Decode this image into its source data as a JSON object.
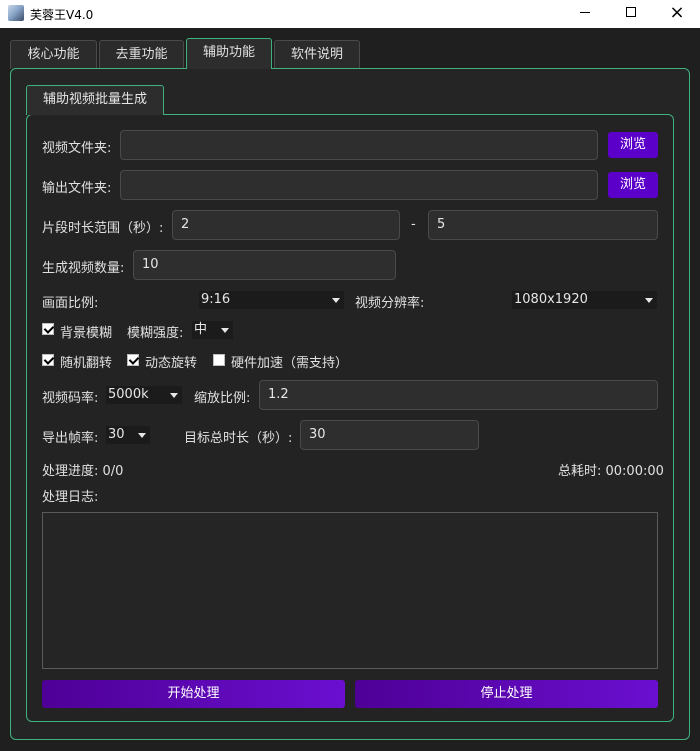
{
  "window": {
    "title": "芙蓉王V4.0"
  },
  "tabs": [
    {
      "label": "核心功能"
    },
    {
      "label": "去重功能"
    },
    {
      "label": "辅助功能"
    },
    {
      "label": "软件说明"
    }
  ],
  "active_tab": 2,
  "subtab": {
    "label": "辅助视频批量生成"
  },
  "video_folder": {
    "label": "视频文件夹:",
    "value": "",
    "browse": "浏览"
  },
  "output_folder": {
    "label": "输出文件夹:",
    "value": "",
    "browse": "浏览"
  },
  "segment_range": {
    "label": "片段时长范围（秒）:",
    "min": "2",
    "dash": "-",
    "max": "5"
  },
  "video_count": {
    "label": "生成视频数量:",
    "value": "10"
  },
  "aspect_ratio": {
    "label": "画面比例:",
    "value": "9:16"
  },
  "resolution": {
    "label": "视频分辨率:",
    "value": "1080x1920"
  },
  "blur_bg": {
    "label": "背景模糊",
    "checked": true
  },
  "blur_strength": {
    "label": "模糊强度:",
    "value": "中"
  },
  "random_flip": {
    "label": "随机翻转",
    "checked": true
  },
  "dynamic_rotate": {
    "label": "动态旋转",
    "checked": true
  },
  "hw_accel": {
    "label": "硬件加速（需支持）",
    "checked": false
  },
  "bitrate": {
    "label": "视频码率:",
    "value": "5000k"
  },
  "scale": {
    "label": "缩放比例:",
    "value": "1.2"
  },
  "fps": {
    "label": "导出帧率:",
    "value": "30"
  },
  "total_duration": {
    "label": "目标总时长（秒）:",
    "value": "30"
  },
  "progress": {
    "text": "处理进度: 0/0"
  },
  "elapsed": {
    "text": "总耗时: 00:00:00"
  },
  "log": {
    "label": "处理日志:",
    "content": ""
  },
  "actions": {
    "start": "开始处理",
    "stop": "停止处理"
  },
  "colors": {
    "accent_green": "#3fb27f",
    "accent_purple": "#5a00c8",
    "background": "#1f1f1f"
  }
}
